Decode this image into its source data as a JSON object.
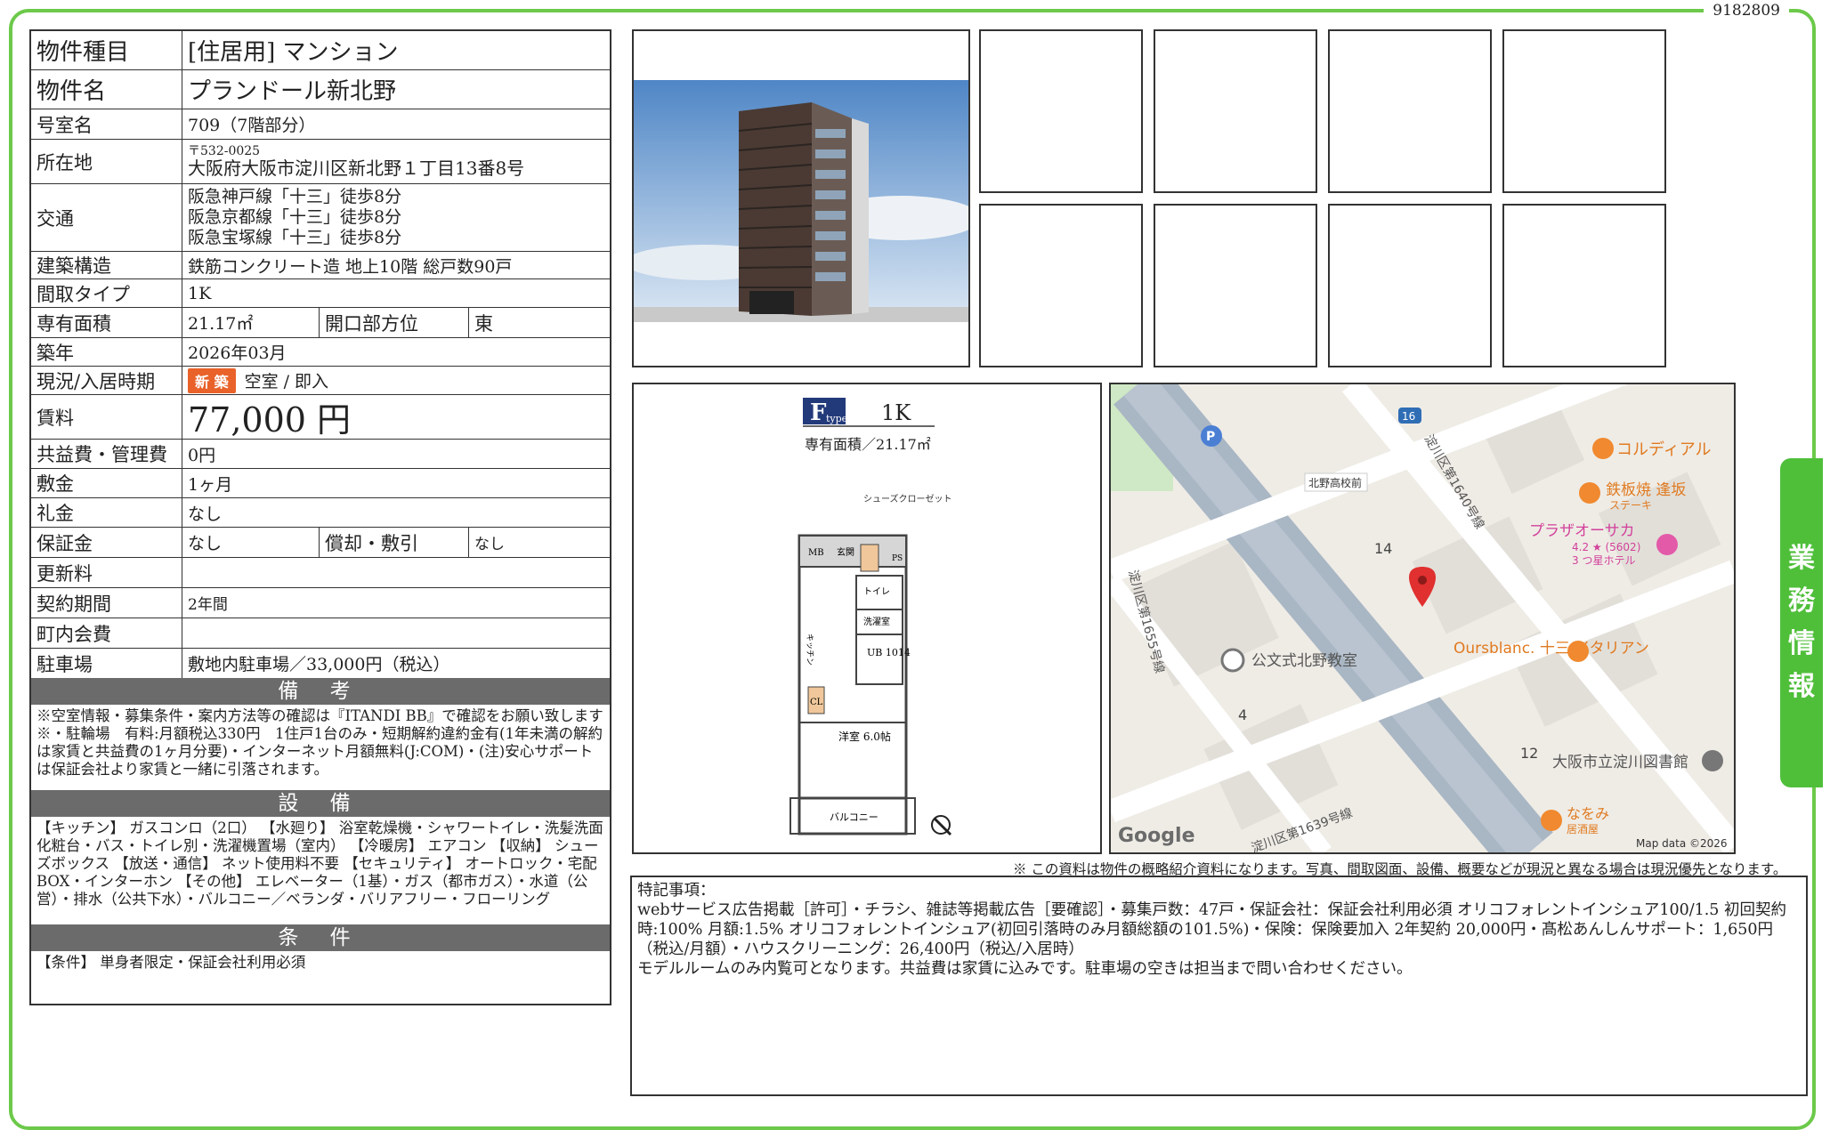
{
  "doc_id": "9182809",
  "side_tab": [
    "業",
    "務",
    "情",
    "報"
  ],
  "property": {
    "type_label": "物件種目",
    "type_value": "[住居用] マンション",
    "name_label": "物件名",
    "name_value": "プランドール新北野",
    "room_label": "号室名",
    "room_value": "709（7階部分）",
    "address_label": "所在地",
    "postal": "〒532-0025",
    "address_value": "大阪府大阪市淀川区新北野１丁目13番8号",
    "transit_label": "交通",
    "transit": [
      "阪急神戸線「十三」徒歩8分",
      "阪急京都線「十三」徒歩8分",
      "阪急宝塚線「十三」徒歩8分"
    ],
    "structure_label": "建築構造",
    "structure_value": "鉄筋コンクリート造 地上10階 総戸数90戸",
    "layout_label": "間取タイプ",
    "layout_value": "1K",
    "area_label": "専有面積",
    "area_value": "21.17㎡",
    "facing_label": "開口部方位",
    "facing_value": "東",
    "built_label": "築年",
    "built_value": "2026年03月",
    "status_label": "現況/入居時期",
    "status_badge": "新 築",
    "status_value": "空室 / 即入",
    "rent_label": "賃料",
    "rent_value": "77,000 円",
    "fee_label": "共益費・管理費",
    "fee_value": "0円",
    "deposit_label": "敷金",
    "deposit_value": "1ヶ月",
    "keymoney_label": "礼金",
    "keymoney_value": "なし",
    "guarantee_label": "保証金",
    "guarantee_value": "なし",
    "amort_label": "償却・敷引",
    "amort_value": "なし",
    "renewal_label": "更新料",
    "renewal_value": "",
    "contract_label": "契約期間",
    "contract_value": "2年間",
    "town_label": "町内会費",
    "town_value": "",
    "parking_label": "駐車場",
    "parking_value": "敷地内駐車場／33,000円（税込）"
  },
  "sections": {
    "remarks_title": "備 考",
    "remarks_text": "※空室情報・募集条件・案内方法等の確認は『ITANDI BB』で確認をお願い致します※・駐輪場　有料:月額税込330円　1住戸1台のみ・短期解約違約金有(1年未満の解約は家賃と共益費の1ヶ月分要)・インターネット月額無料(J:COM)・(注)安心サポートは保証会社より家賃と一緒に引落されます。",
    "equipment_title": "設 備",
    "equipment_text": "【キッチン】 ガスコンロ（2口） 【水廻り】 浴室乾燥機・シャワートイレ・洗髪洗面化粧台・バス・トイレ別・洗濯機置場（室内） 【冷暖房】 エアコン 【収納】 シューズボックス 【放送・通信】 ネット使用料不要 【セキュリティ】 オートロック・宅配BOX・インターホン 【その他】 エレベーター（1基）・ガス（都市ガス）・水道（公営）・排水（公共下水）・バルコニー／ベランダ・バリアフリー・フローリング",
    "conditions_title": "条 件",
    "conditions_text": "【条件】 単身者限定・保証会社利用必須"
  },
  "floorplan": {
    "type_letter": "F",
    "type_word": "type",
    "layout": "1K",
    "area_text": "専有面積／21.17㎡",
    "rooms": [
      "シューズクローゼット",
      "MB",
      "玄関",
      "PS",
      "トイレ",
      "洗濯室",
      "UB 1014",
      "CL",
      "洋室 6.0帖",
      "バルコニー",
      "キッチン"
    ]
  },
  "map": {
    "labels": [
      "コルディアル",
      "鉄板焼 逢坂",
      "ステーキ",
      "プラザオーサカ",
      "4.2 ★ (5602)",
      "3 つ星ホテル",
      "北野高校前",
      "14",
      "淀川区第1640号線",
      "淀川区第1655号線",
      "公文式北野教室",
      "Oursblanc. 十三 イタリアン",
      "4",
      "12",
      "大阪市立淀川図書館",
      "なをみ",
      "居酒屋",
      "淀川区第1639号線",
      "16",
      "P"
    ],
    "google": "Google",
    "attribution": "Map data ©2026"
  },
  "disclaimer": "※ この資料は物件の概略紹介資料になります。写真、間取図面、設備、概要などが現況と異なる場合は現況優先となります。",
  "notes": {
    "title": "特記事項：",
    "line1": "webサービス広告掲載［許可］・チラシ、雑誌等掲載広告［要確認］・募集戸数：47戸・保証会社：保証会社利用必須 オリコフォレントインシュア100/1.5 初回契約時:100% 月額:1.5% オリコフォレントインシュア(初回引落時のみ月額総額の101.5%)・保険：保険要加入 2年契約 20,000円・髙松あんしんサポート：1,650円（税込/月額）・ハウスクリーニング：26,400円（税込/入居時）",
    "line2": "モデルルームのみ内覧可となります。共益費は家賃に込みです。駐車場の空きは担当まで問い合わせください。"
  },
  "colors": {
    "frame": "#6cc94a",
    "tab": "#4fbf3a",
    "section_bar": "#6b6b6b",
    "badge": "#e8622a",
    "pin": "#e0302f"
  }
}
